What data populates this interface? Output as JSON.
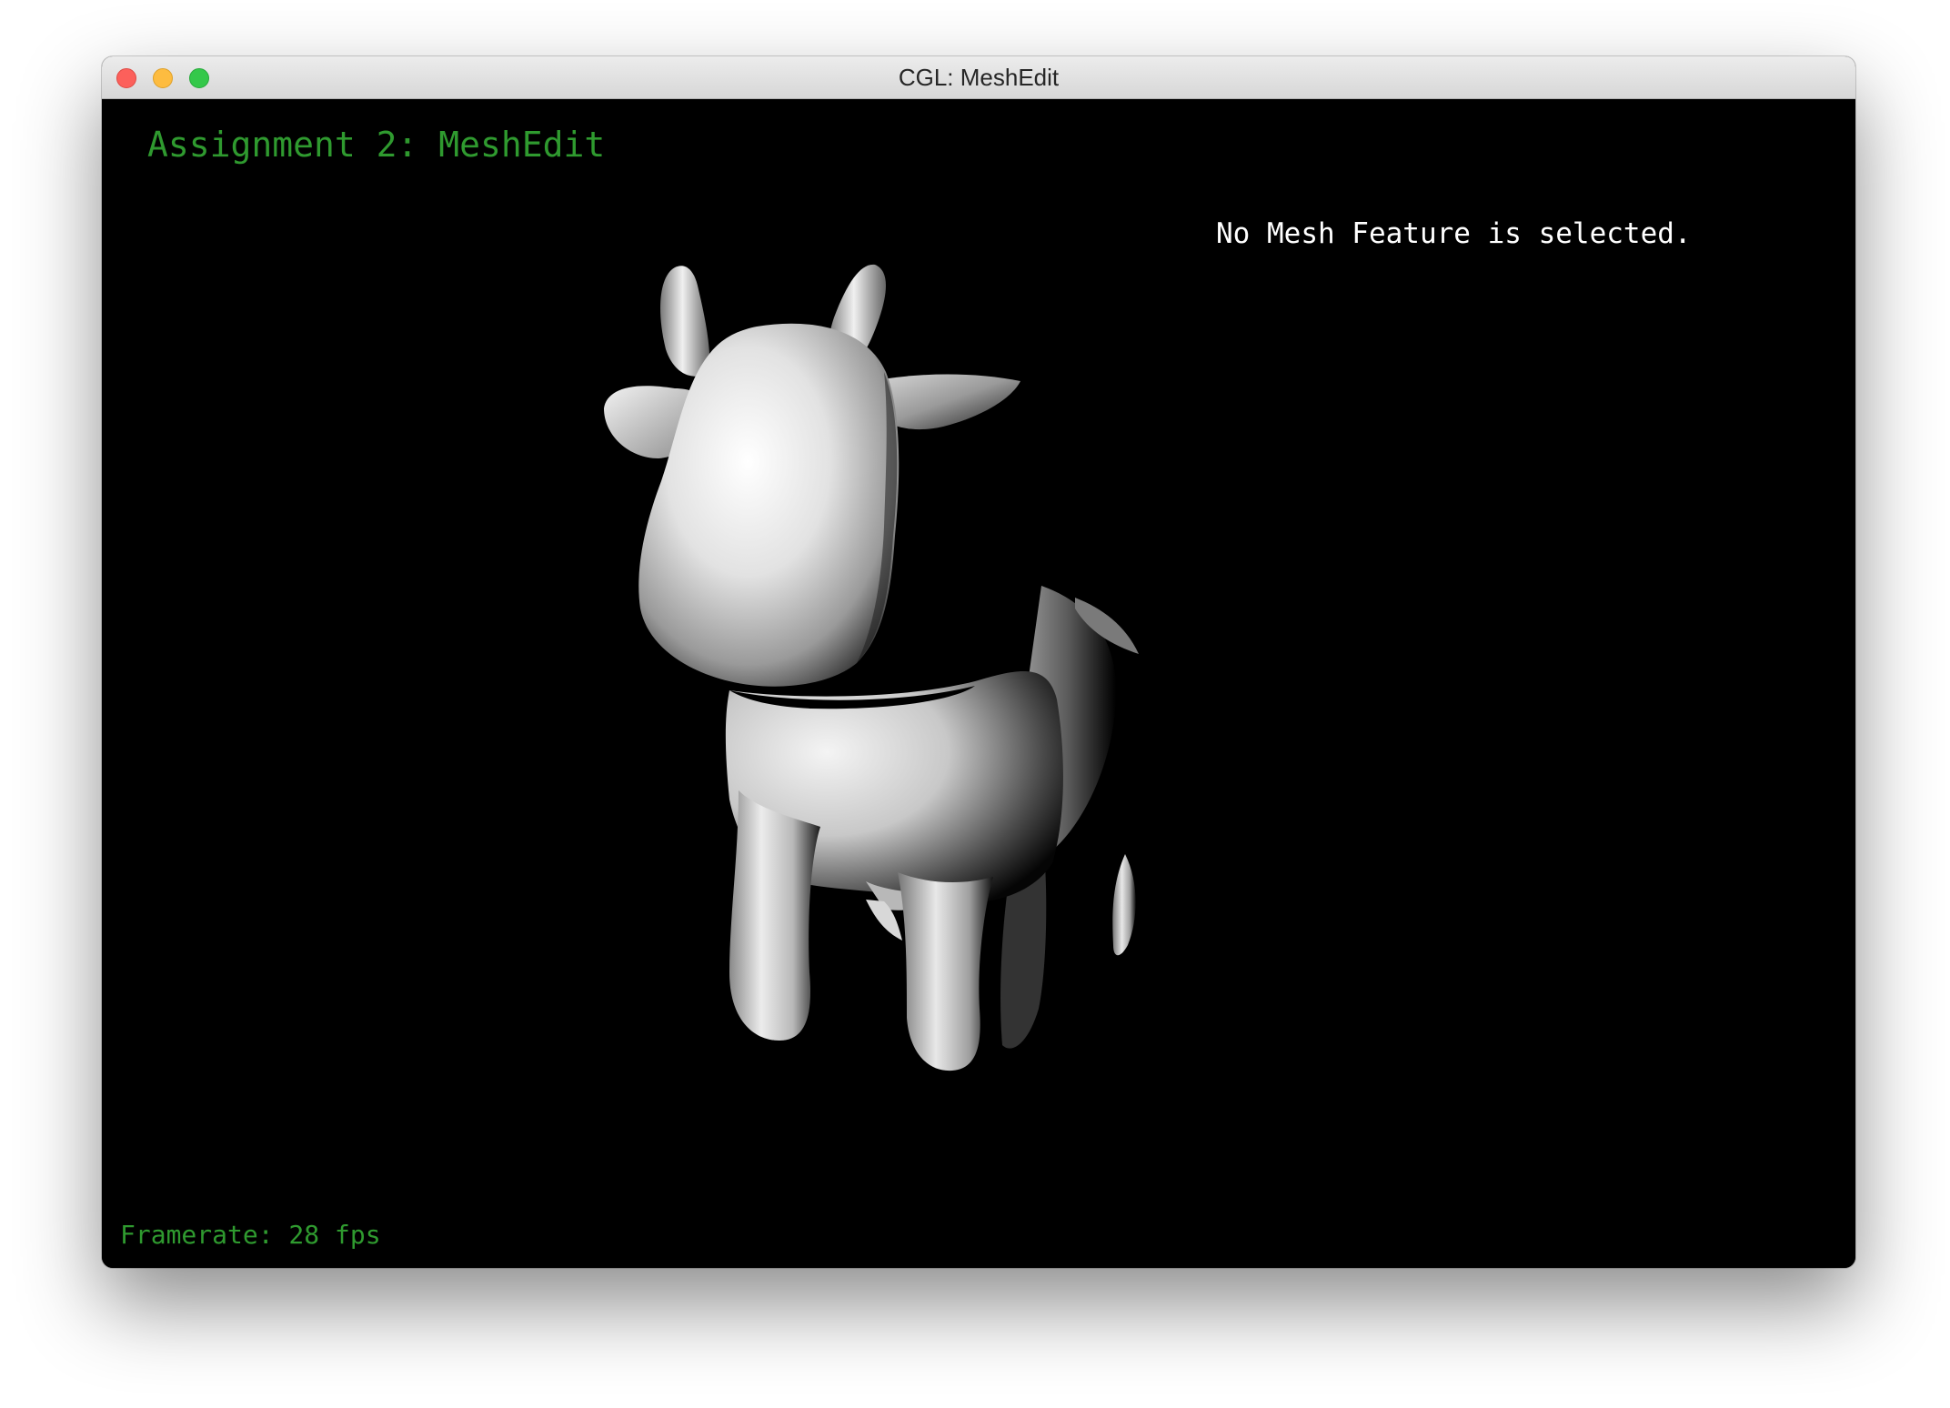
{
  "window": {
    "title": "CGL: MeshEdit"
  },
  "viewport": {
    "app_title": "Assignment 2: MeshEdit",
    "selection_status": "No Mesh Feature is selected.",
    "framerate": "Framerate: 28 fps",
    "colors": {
      "background": "#000000",
      "hud_green": "#2f9a2f",
      "status_text": "#ffffff"
    }
  },
  "icons": {
    "close": "close-button-icon",
    "minimize": "minimize-button-icon",
    "maximize": "maximize-button-icon",
    "mesh": "cow-mesh"
  }
}
